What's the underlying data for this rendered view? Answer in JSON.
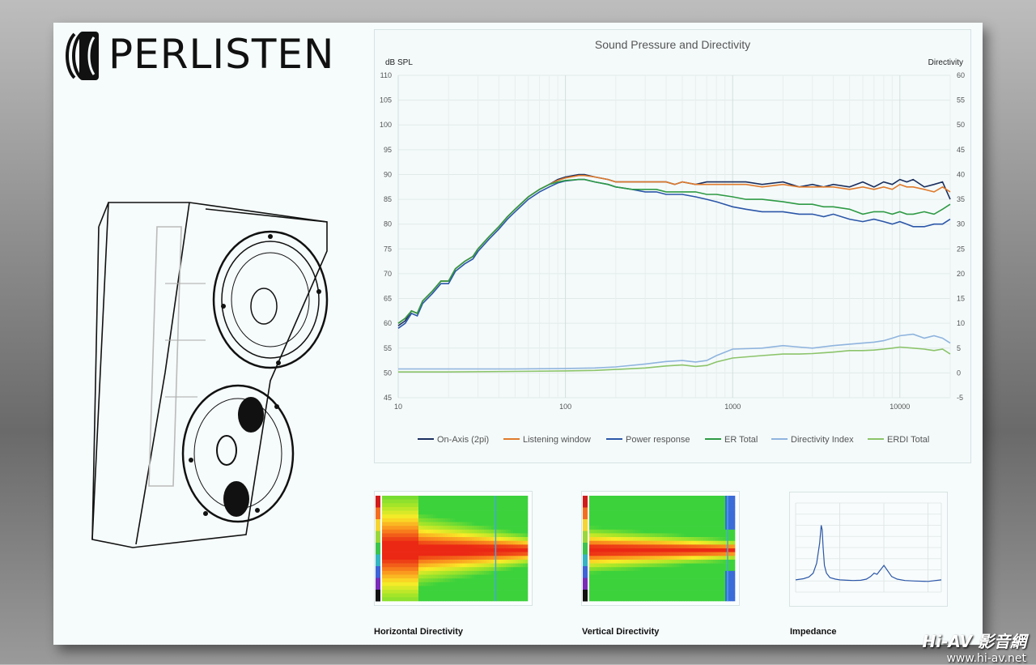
{
  "brand": {
    "name": "PERLISTEN"
  },
  "chart_data": [
    {
      "type": "line",
      "title": "Sound Pressure and Directivity",
      "ylabel": "dB SPL",
      "y2label": "Directivity",
      "xscale": "log",
      "xlim": [
        10,
        20000
      ],
      "ylim": [
        45,
        110
      ],
      "y2lim": [
        -5,
        60
      ],
      "xticks": [
        "10",
        "100",
        "1000",
        "10000"
      ],
      "yticks": [
        "45",
        "50",
        "55",
        "60",
        "65",
        "70",
        "75",
        "80",
        "85",
        "90",
        "95",
        "100",
        "105",
        "110"
      ],
      "y2ticks": [
        "-5",
        "0",
        "5",
        "10",
        "15",
        "20",
        "25",
        "30",
        "35",
        "40",
        "45",
        "50",
        "55",
        "60"
      ],
      "grid": true,
      "legend_position": "bottom",
      "series": [
        {
          "name": "On-Axis (2pi)",
          "color": "#1b2f5e",
          "axis": "left",
          "x": [
            10,
            11,
            12,
            13,
            14,
            16,
            18,
            20,
            22,
            25,
            28,
            30,
            35,
            40,
            45,
            50,
            60,
            70,
            80,
            90,
            100,
            120,
            130,
            150,
            180,
            200,
            250,
            300,
            350,
            400,
            450,
            500,
            600,
            700,
            800,
            1000,
            1200,
            1500,
            2000,
            2500,
            3000,
            3500,
            4000,
            5000,
            6000,
            7000,
            8000,
            9000,
            10000,
            11000,
            12000,
            14000,
            16000,
            18000,
            20000
          ],
          "y": [
            59.5,
            60.5,
            62.5,
            62,
            64.5,
            66.5,
            68.5,
            68.5,
            71,
            72.5,
            73.5,
            75,
            77.5,
            79.5,
            81.5,
            83,
            85.5,
            87,
            88,
            89,
            89.5,
            90,
            90,
            89.5,
            89,
            88.5,
            88.5,
            88.5,
            88.5,
            88.5,
            88,
            88.5,
            88,
            88.5,
            88.5,
            88.5,
            88.5,
            88,
            88.5,
            87.5,
            88,
            87.5,
            88,
            87.5,
            88.5,
            87.5,
            88.5,
            88,
            89,
            88.5,
            89,
            87.5,
            88,
            88.5,
            85
          ]
        },
        {
          "name": "Listening window",
          "color": "#e07a2b",
          "axis": "left",
          "x": [
            10,
            11,
            12,
            13,
            14,
            16,
            18,
            20,
            22,
            25,
            28,
            30,
            35,
            40,
            45,
            50,
            60,
            70,
            80,
            90,
            100,
            120,
            130,
            150,
            180,
            200,
            250,
            300,
            350,
            400,
            450,
            500,
            600,
            700,
            800,
            1000,
            1200,
            1500,
            2000,
            2500,
            3000,
            3500,
            4000,
            5000,
            6000,
            7000,
            8000,
            9000,
            10000,
            11000,
            12000,
            14000,
            16000,
            18000,
            20000
          ],
          "y": [
            60,
            61,
            62.5,
            62,
            64.5,
            66.5,
            68.5,
            68.5,
            71,
            72.5,
            73.5,
            75,
            77.5,
            79.5,
            81.5,
            83,
            85.5,
            87,
            88,
            88.8,
            89.3,
            89.8,
            89.8,
            89.5,
            89,
            88.5,
            88.5,
            88.5,
            88.5,
            88.5,
            88,
            88.5,
            88,
            88,
            88,
            88,
            88,
            87.5,
            88,
            87.5,
            87.5,
            87.5,
            87.5,
            87,
            87.5,
            87,
            87.5,
            87,
            88,
            87.5,
            87.5,
            87,
            86.5,
            87.5,
            86.5
          ]
        },
        {
          "name": "Power response",
          "color": "#2b56a8",
          "axis": "left",
          "x": [
            10,
            11,
            12,
            13,
            14,
            16,
            18,
            20,
            22,
            25,
            28,
            30,
            35,
            40,
            45,
            50,
            60,
            70,
            80,
            90,
            100,
            120,
            130,
            150,
            180,
            200,
            250,
            300,
            350,
            400,
            450,
            500,
            600,
            700,
            800,
            1000,
            1200,
            1500,
            2000,
            2500,
            3000,
            3500,
            4000,
            5000,
            6000,
            7000,
            8000,
            9000,
            10000,
            11000,
            12000,
            14000,
            16000,
            18000,
            20000
          ],
          "y": [
            59,
            60,
            62,
            61.5,
            64,
            66,
            68,
            68,
            70.5,
            72,
            73,
            74.5,
            77,
            79,
            81,
            82.5,
            85,
            86.5,
            87.5,
            88.3,
            88.7,
            89,
            89,
            88.5,
            88,
            87.5,
            87,
            86.5,
            86.5,
            86,
            86,
            86,
            85.5,
            85,
            84.5,
            83.5,
            83,
            82.5,
            82.5,
            82,
            82,
            81.5,
            82,
            81,
            80.5,
            81,
            80.5,
            80,
            80.5,
            80,
            79.5,
            79.5,
            80,
            80,
            81
          ]
        },
        {
          "name": "ER Total",
          "color": "#2e9a44",
          "axis": "left",
          "x": [
            10,
            11,
            12,
            13,
            14,
            16,
            18,
            20,
            22,
            25,
            28,
            30,
            35,
            40,
            45,
            50,
            60,
            70,
            80,
            90,
            100,
            120,
            130,
            150,
            180,
            200,
            250,
            300,
            350,
            400,
            450,
            500,
            600,
            700,
            800,
            1000,
            1200,
            1500,
            2000,
            2500,
            3000,
            3500,
            4000,
            5000,
            6000,
            7000,
            8000,
            9000,
            10000,
            11000,
            12000,
            14000,
            16000,
            18000,
            20000
          ],
          "y": [
            60,
            61,
            62.5,
            62,
            64.5,
            66.5,
            68.5,
            68.5,
            71,
            72.5,
            73.5,
            75,
            77.5,
            79.5,
            81.5,
            83,
            85.5,
            87,
            88,
            88.5,
            88.8,
            89,
            89,
            88.5,
            88,
            87.5,
            87,
            87,
            87,
            86.5,
            86.5,
            86.5,
            86.5,
            86,
            86,
            85.5,
            85,
            85,
            84.5,
            84,
            84,
            83.5,
            83.5,
            83,
            82,
            82.5,
            82.5,
            82,
            82.5,
            82,
            82,
            82.5,
            82,
            83,
            84
          ]
        },
        {
          "name": "Directivity Index",
          "color": "#8fb4de",
          "axis": "right",
          "x": [
            10,
            20,
            50,
            100,
            150,
            200,
            300,
            400,
            500,
            600,
            700,
            800,
            1000,
            1500,
            2000,
            2500,
            3000,
            4000,
            5000,
            6000,
            7000,
            8000,
            9000,
            10000,
            12000,
            14000,
            16000,
            18000,
            20000
          ],
          "y": [
            0.8,
            0.8,
            0.8,
            0.9,
            1.0,
            1.2,
            1.8,
            2.3,
            2.5,
            2.2,
            2.5,
            3.5,
            4.8,
            5.0,
            5.5,
            5.2,
            5.0,
            5.5,
            5.8,
            6.0,
            6.2,
            6.5,
            7.0,
            7.5,
            7.8,
            7.0,
            7.5,
            7.0,
            6.0
          ]
        },
        {
          "name": "ERDI Total",
          "color": "#8cc46a",
          "axis": "right",
          "x": [
            10,
            20,
            50,
            100,
            150,
            200,
            300,
            400,
            500,
            600,
            700,
            800,
            1000,
            1500,
            2000,
            2500,
            3000,
            4000,
            5000,
            6000,
            7000,
            8000,
            9000,
            10000,
            12000,
            14000,
            16000,
            18000,
            20000
          ],
          "y": [
            0.2,
            0.2,
            0.3,
            0.4,
            0.5,
            0.7,
            1.0,
            1.4,
            1.6,
            1.3,
            1.5,
            2.2,
            3.0,
            3.5,
            3.8,
            3.8,
            3.9,
            4.2,
            4.5,
            4.5,
            4.6,
            4.8,
            5.0,
            5.2,
            5.0,
            4.8,
            4.5,
            4.8,
            3.8
          ]
        }
      ]
    },
    {
      "type": "heatmap",
      "title": "Horizontal Directivity",
      "mode": "horizontal"
    },
    {
      "type": "heatmap",
      "title": "Vertical Directivity",
      "mode": "vertical"
    },
    {
      "type": "line",
      "title": "Impedance",
      "xscale": "log",
      "series": [
        {
          "color": "#2b56a8",
          "x": [
            10,
            15,
            20,
            25,
            30,
            35,
            38,
            40,
            42,
            45,
            50,
            60,
            80,
            100,
            150,
            200,
            300,
            400,
            500,
            600,
            700,
            800,
            1000,
            1500,
            2000,
            3000,
            5000,
            10000,
            20000
          ],
          "y": [
            5.5,
            6.0,
            6.8,
            8.5,
            13,
            22,
            30,
            28,
            20,
            12,
            8.5,
            6.5,
            5.8,
            5.5,
            5.3,
            5.2,
            5.3,
            5.8,
            7,
            8.5,
            8.0,
            9.5,
            12,
            7,
            5.8,
            5.2,
            5.0,
            4.8,
            5.5
          ]
        }
      ]
    }
  ],
  "captions": {
    "horizontal": "Horizontal Directivity",
    "vertical": "Vertical Directivity",
    "impedance": "Impedance"
  },
  "watermark": {
    "logo": "Hi-AV 影音網",
    "url": "www.hi-av.net"
  },
  "colors": {
    "sheet_bg": "#f6fbfb",
    "grid": "#e4eaea",
    "axis_text": "#333333"
  }
}
